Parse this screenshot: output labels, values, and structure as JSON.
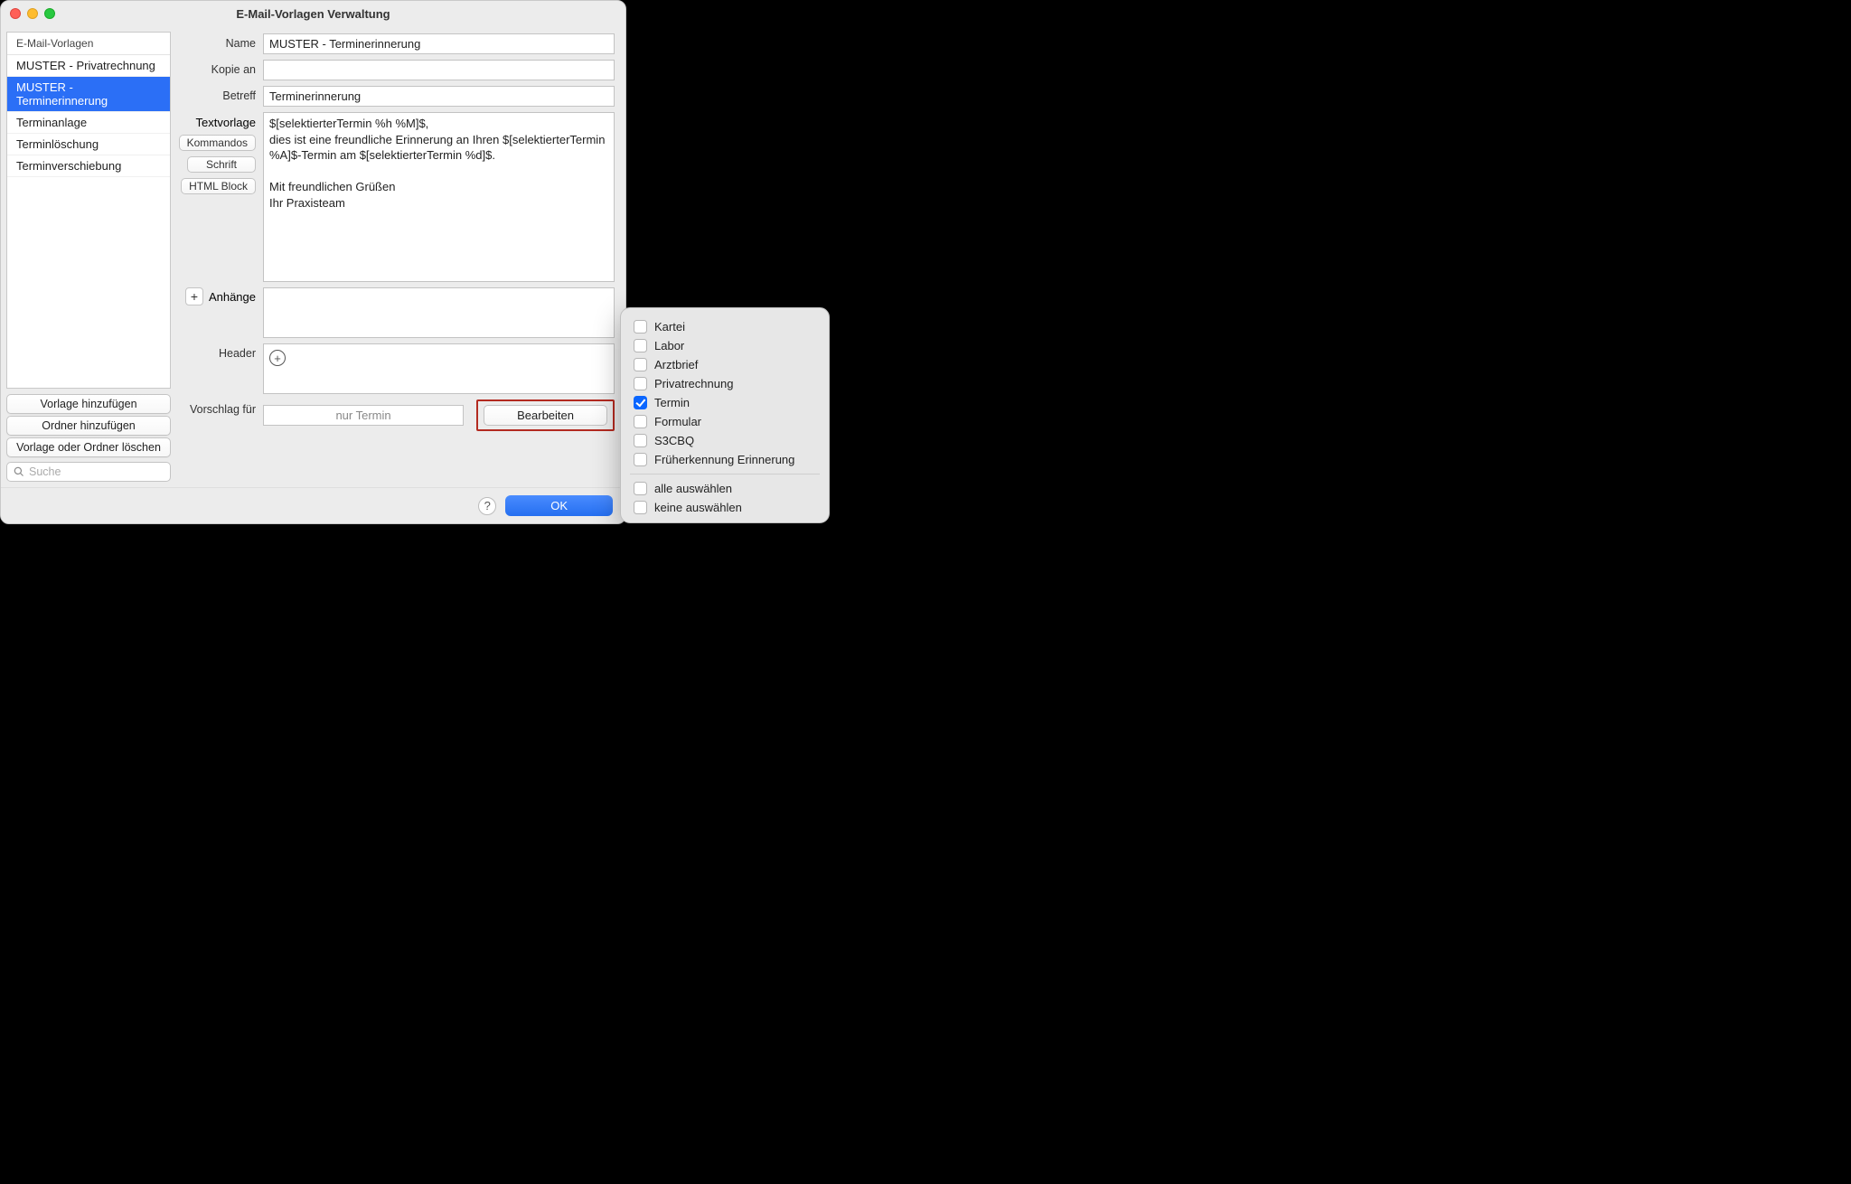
{
  "window": {
    "title": "E-Mail-Vorlagen Verwaltung"
  },
  "sidebar": {
    "header": "E-Mail-Vorlagen",
    "items": [
      {
        "label": "MUSTER - Privatrechnung",
        "selected": false
      },
      {
        "label": "MUSTER - Terminerinnerung",
        "selected": true
      },
      {
        "label": "Terminanlage",
        "selected": false
      },
      {
        "label": "Terminlöschung",
        "selected": false
      },
      {
        "label": "Terminverschiebung",
        "selected": false
      }
    ],
    "buttons": {
      "add_template": "Vorlage hinzufügen",
      "add_folder": "Ordner hinzufügen",
      "delete": "Vorlage oder Ordner löschen"
    },
    "search_placeholder": "Suche"
  },
  "form": {
    "labels": {
      "name": "Name",
      "copy": "Kopie an",
      "subject": "Betreff",
      "text": "Textvorlage",
      "attachments": "Anhänge",
      "header": "Header",
      "suggestion": "Vorschlag für"
    },
    "name_value": "MUSTER - Terminerinnerung",
    "copy_value": "",
    "subject_value": "Terminerinnerung",
    "text_value": "$[selektierterTermin %h %M]$,\ndies ist eine freundliche Erinnerung an Ihren $[selektierterTermin %A]$-Termin am $[selektierterTermin %d]$.\n\nMit freundlichen Grüßen\nIhr Praxisteam",
    "side_buttons": {
      "commands": "Kommandos",
      "font": "Schrift",
      "html": "HTML Block"
    },
    "suggestion_value": "nur Termin",
    "edit_button": "Bearbeiten"
  },
  "footer": {
    "ok": "OK",
    "help": "?"
  },
  "popover": {
    "options": [
      {
        "label": "Kartei",
        "checked": false
      },
      {
        "label": "Labor",
        "checked": false
      },
      {
        "label": "Arztbrief",
        "checked": false
      },
      {
        "label": "Privatrechnung",
        "checked": false
      },
      {
        "label": "Termin",
        "checked": true
      },
      {
        "label": "Formular",
        "checked": false
      },
      {
        "label": "S3CBQ",
        "checked": false
      },
      {
        "label": "Früherkennung Erinnerung",
        "checked": false
      }
    ],
    "select_all": "alle auswählen",
    "select_none": "keine auswählen"
  }
}
